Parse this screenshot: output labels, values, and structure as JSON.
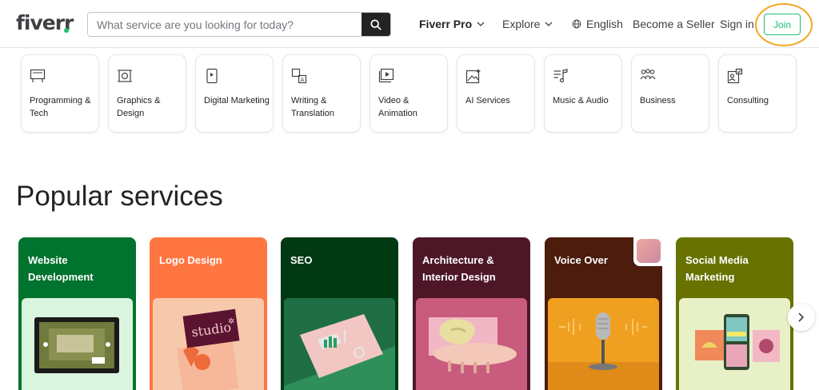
{
  "header": {
    "logo": "fiverr",
    "search_placeholder": "What service are you looking for today?",
    "nav": {
      "fiverr_pro": "Fiverr Pro",
      "explore": "Explore",
      "language": "English",
      "become_seller": "Become a Seller",
      "sign_in": "Sign in",
      "join": "Join"
    }
  },
  "categories": [
    {
      "label": "Programming & Tech",
      "icon": "monitor-code-icon"
    },
    {
      "label": "Graphics & Design",
      "icon": "design-frame-icon"
    },
    {
      "label": "Digital Marketing",
      "icon": "phone-chart-icon"
    },
    {
      "label": "Writing & Translation",
      "icon": "translate-icon"
    },
    {
      "label": "Video & Animation",
      "icon": "play-video-icon"
    },
    {
      "label": "AI Services",
      "icon": "ai-sparkle-icon"
    },
    {
      "label": "Music & Audio",
      "icon": "music-note-icon"
    },
    {
      "label": "Business",
      "icon": "people-group-icon"
    },
    {
      "label": "Consulting",
      "icon": "consulting-icon"
    }
  ],
  "popular": {
    "title": "Popular services",
    "services": [
      {
        "label": "Website Development",
        "bg": "#00732e",
        "img_bg": "#d9f5df"
      },
      {
        "label": "Logo Design",
        "bg": "#ff7640",
        "img_bg": "#f6c9ad"
      },
      {
        "label": "SEO",
        "bg": "#003912",
        "img_bg": "#2f8f5a"
      },
      {
        "label": "Architecture & Interior Design",
        "bg": "#4d1727",
        "img_bg": "#c85b7e"
      },
      {
        "label": "Voice Over",
        "bg": "#687200",
        "img_bg": "#f0a020"
      },
      {
        "label": "Social Media Marketing",
        "bg": "#687200",
        "img_bg": "#e8f0c8"
      }
    ]
  },
  "colors": {
    "brand_green": "#1dbf73",
    "highlight": "#f5a623"
  }
}
